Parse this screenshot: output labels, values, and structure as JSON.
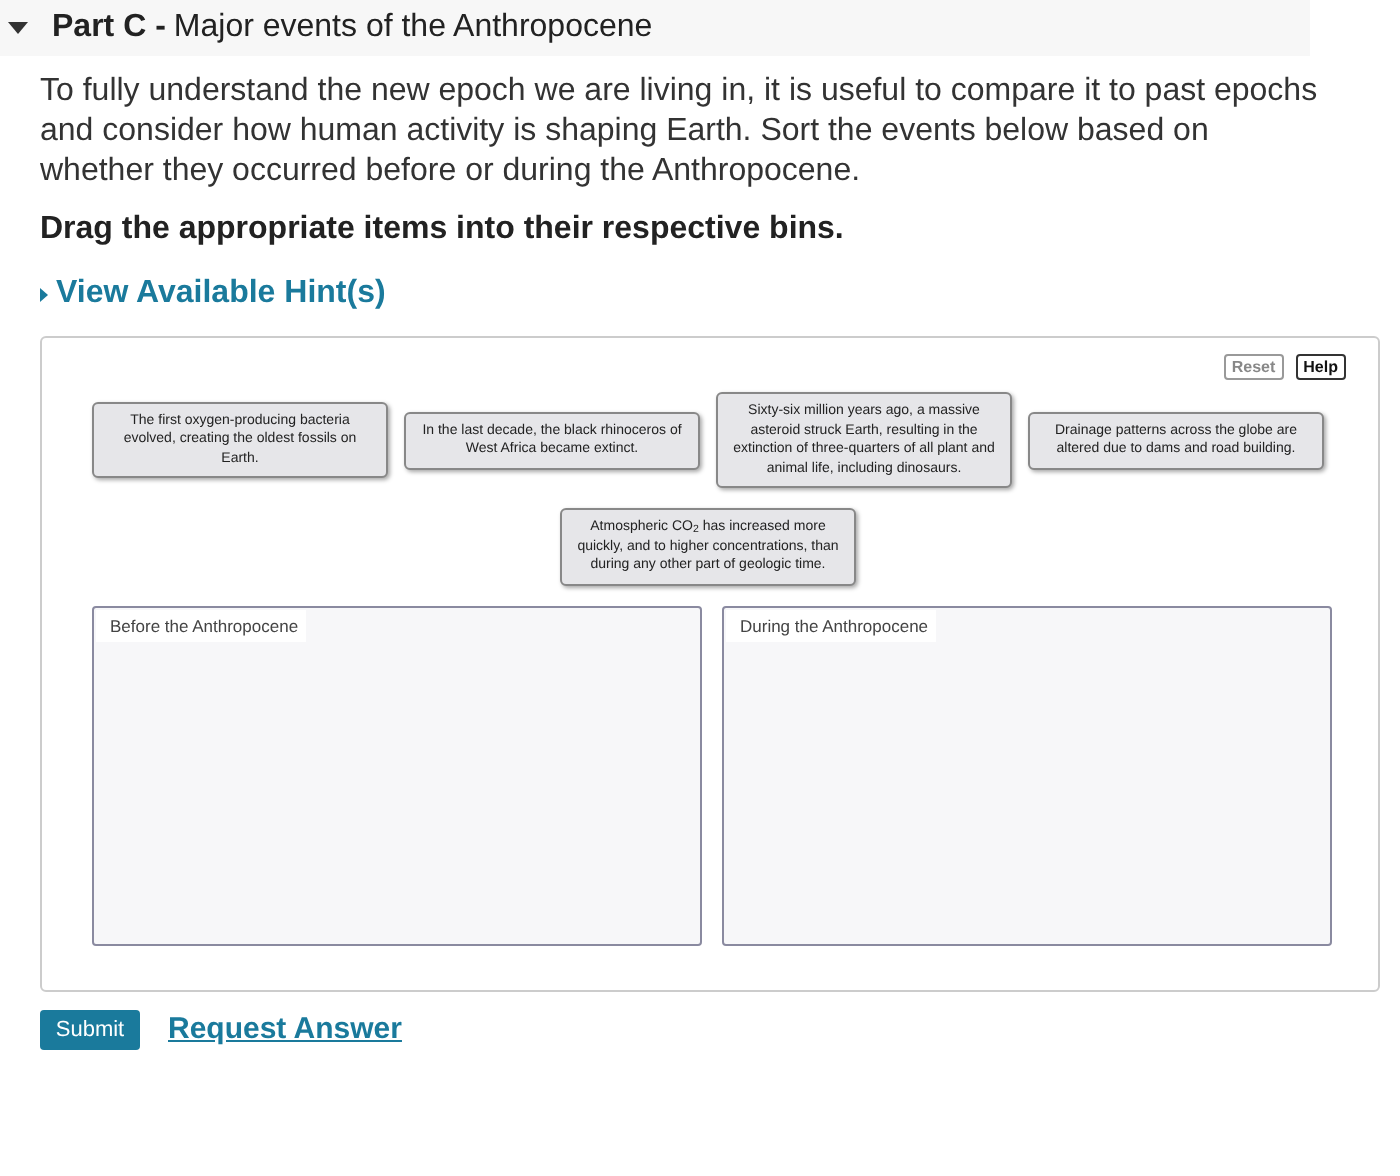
{
  "part": {
    "label": "Part C -",
    "title": "Major events of the Anthropocene"
  },
  "intro": "To fully understand the new epoch we are living in, it is useful to compare it to past epochs and consider how human activity is shaping Earth. Sort the events below based on whether they occurred before or during the Anthropocene.",
  "instruction": "Drag the appropriate items into their respective bins.",
  "hint_link": "View Available Hint(s)",
  "toolbar": [
    "Reset",
    "Help"
  ],
  "items": [
    {
      "text": "The first oxygen-producing bacteria evolved, creating the oldest fossils on Earth."
    },
    {
      "text": "In the last decade, the black rhinoceros of West Africa became extinct."
    },
    {
      "text": "Sixty-six million years ago, a massive asteroid struck Earth, resulting in the extinction of three-quarters of all plant and animal life, including dinosaurs."
    },
    {
      "text": "Drainage patterns across the globe are altered due to dams and road building."
    },
    {
      "text": "Atmospheric CO$_{2}$ has increased more quickly, and to higher concentrations, than during any other part of geologic time."
    }
  ],
  "bins": [
    {
      "label": "Before the Anthropocene"
    },
    {
      "label": "During the Anthropocene"
    }
  ],
  "submit": "Submit",
  "request_answer": "Request Answer"
}
